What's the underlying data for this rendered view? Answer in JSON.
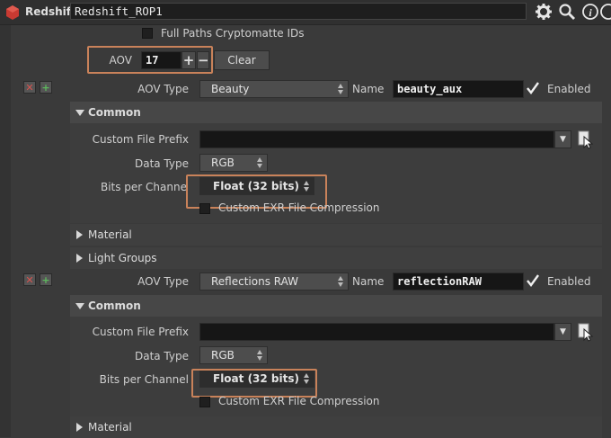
{
  "topbar": {
    "node_type": "Redshift",
    "node_name": "Redshift_ROP1",
    "icons": [
      "gear-icon",
      "search-icon",
      "info-icon",
      "help-icon"
    ]
  },
  "cryptomatte": {
    "label": "Full Paths Cryptomatte IDs",
    "checked": false
  },
  "aov_row": {
    "label": "AOV",
    "count": "17",
    "plus": "+",
    "minus": "−",
    "clear_label": "Clear"
  },
  "aovs": [
    {
      "type_label": "AOV Type",
      "type_value": "Beauty",
      "name_label": "Name",
      "name_value": "beauty_aux",
      "enabled_label": "Enabled",
      "common": {
        "folder_label": "Common",
        "prefix_label": "Custom File Prefix",
        "prefix_value": "",
        "datatype_label": "Data Type",
        "datatype_value": "RGB",
        "bits_label": "Bits per Channe",
        "bits_value": "Float (32 bits)",
        "exr_label": "Custom EXR File Compression"
      },
      "material_label": "Material",
      "lightgroups_label": "Light Groups"
    },
    {
      "type_label": "AOV Type",
      "type_value": "Reflections RAW",
      "name_label": "Name",
      "name_value": "reflectionRAW",
      "enabled_label": "Enabled",
      "common": {
        "folder_label": "Common",
        "prefix_label": "Custom File Prefix",
        "prefix_value": "",
        "datatype_label": "Data Type",
        "datatype_value": "RGB",
        "bits_label": "Bits per Channel",
        "bits_value": "Float (32 bits)",
        "exr_label": "Custom EXR File Compression"
      },
      "material_label": "Material"
    }
  ],
  "colors": {
    "highlight": "#c9825a",
    "remove": "#d9534f",
    "add": "#5cb85c"
  }
}
